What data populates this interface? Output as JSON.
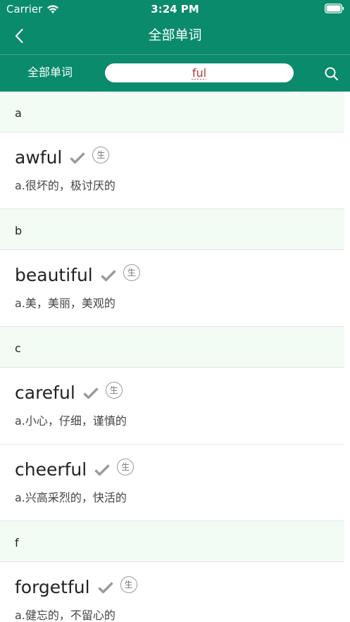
{
  "status_bar": {
    "carrier": "Carrier",
    "time": "3:24 PM"
  },
  "nav": {
    "title": "全部单词"
  },
  "search": {
    "filter_label": "全部单词",
    "query": "ful"
  },
  "colors": {
    "brand": "#0a8b6b",
    "section_bg": "#f3fcf4",
    "query_text": "#b03a3a",
    "check": "#9a9a9a"
  },
  "sections": [
    {
      "letter": "a",
      "words": [
        {
          "word": "awful",
          "meaning": "a.很坏的，极讨厌的",
          "badge": "生"
        }
      ]
    },
    {
      "letter": "b",
      "words": [
        {
          "word": "beautiful",
          "meaning": "a.美，美丽，美观的",
          "badge": "生"
        }
      ]
    },
    {
      "letter": "c",
      "words": [
        {
          "word": "careful",
          "meaning": "a.小心，仔细，谨慎的",
          "badge": "生"
        },
        {
          "word": "cheerful",
          "meaning": "a.兴高采烈的，快活的",
          "badge": "生"
        }
      ]
    },
    {
      "letter": "f",
      "words": [
        {
          "word": "forgetful",
          "meaning": "a.健忘的，不留心的",
          "badge": "生"
        }
      ]
    }
  ]
}
